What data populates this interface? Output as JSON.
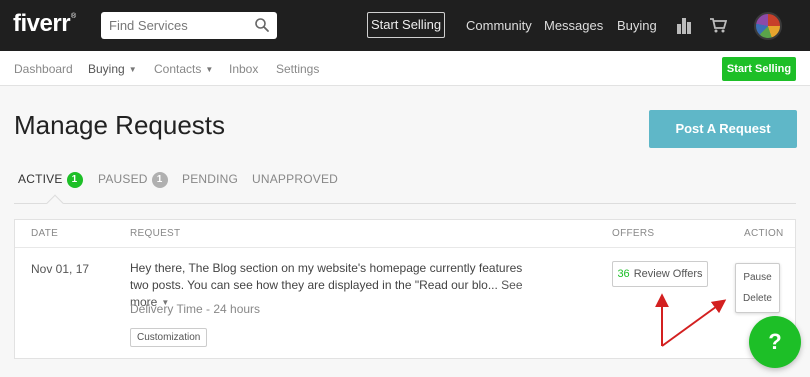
{
  "header": {
    "logo": "fiverr",
    "logo_mark": "®",
    "search_placeholder": "Find Services",
    "start_selling": "Start Selling",
    "community": "Community",
    "messages": "Messages",
    "buying": "Buying",
    "icons": [
      "search-icon",
      "stats-icon",
      "cart-icon",
      "avatar"
    ]
  },
  "subnav": {
    "dashboard": "Dashboard",
    "buying": "Buying",
    "contacts": "Contacts",
    "inbox": "Inbox",
    "settings": "Settings",
    "start_selling": "Start Selling"
  },
  "page": {
    "title": "Manage Requests",
    "post_request": "Post A Request"
  },
  "tabs": [
    {
      "label": "ACTIVE",
      "count": "1"
    },
    {
      "label": "PAUSED",
      "count": "1"
    },
    {
      "label": "PENDING"
    },
    {
      "label": "UNAPPROVED"
    }
  ],
  "table": {
    "headers": {
      "date": "DATE",
      "request": "REQUEST",
      "offers": "OFFERS",
      "action": "ACTION"
    },
    "row": {
      "date": "Nov 01, 17",
      "request": "Hey there, The Blog section on my website's homepage currently features two posts. You can see how they are displayed in the \"Read our blo...",
      "see_more": "See more",
      "delivery": "Delivery Time - 24 hours",
      "tag": "Customization",
      "offers_count": "36",
      "offers_label": "Review Offers",
      "actions": [
        "Pause",
        "Delete"
      ]
    }
  },
  "help_label": "?",
  "colors": {
    "brand_green": "#1dbf27",
    "accent_teal": "#5fb7c8",
    "topbar": "#1f1f1f",
    "annotation": "#d32020"
  }
}
